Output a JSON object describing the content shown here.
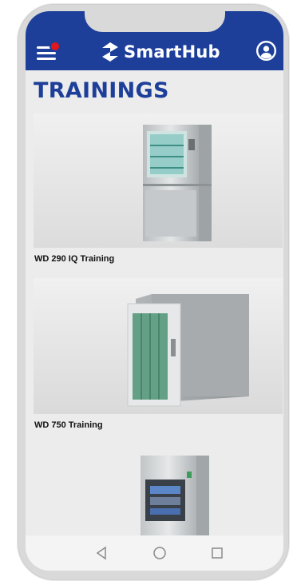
{
  "app": {
    "brand": "SmartHub"
  },
  "page": {
    "title": "TRAININGS"
  },
  "trainings": [
    {
      "label": "WD 290 IQ Training"
    },
    {
      "label": "WD 750 Training"
    },
    {
      "label": ""
    }
  ],
  "icons": {
    "menu": "hamburger-menu-icon",
    "notification": "notification-dot-icon",
    "logo": "smarthub-logo-icon",
    "profile": "user-circle-icon",
    "back": "triangle-back-icon",
    "home": "circle-home-icon",
    "recents": "square-recents-icon"
  },
  "colors": {
    "primary": "#1d3f99",
    "notification": "#e2161c",
    "background": "#ececec"
  }
}
